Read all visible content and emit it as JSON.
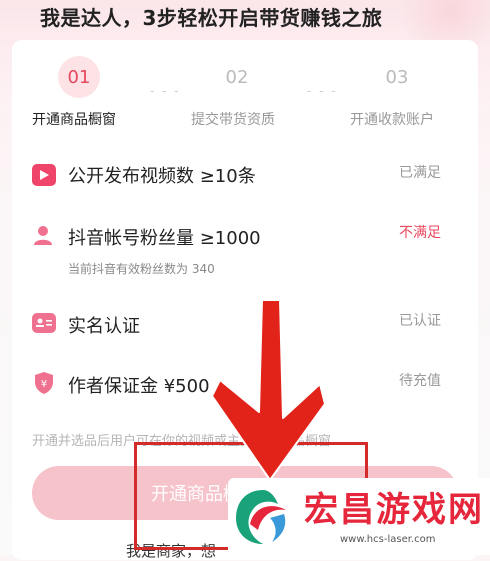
{
  "header": {
    "title": "我是达人，3步轻松开启带货赚钱之旅"
  },
  "steps": [
    {
      "number": "01",
      "label": "开通商品橱窗",
      "active": true
    },
    {
      "number": "02",
      "label": "提交带货资质",
      "active": false
    },
    {
      "number": "03",
      "label": "开通收款账户",
      "active": false
    }
  ],
  "step_separator": "- - -",
  "requirements": [
    {
      "icon": "video-icon",
      "label": "公开发布视频数 ≥10条",
      "status": "已满足"
    },
    {
      "icon": "user-icon",
      "label": "抖音帐号粉丝量 ≥1000",
      "sub": "当前抖音有效粉丝数为 340",
      "status": "不满足"
    },
    {
      "icon": "id-card-icon",
      "label": "实名认证",
      "status": "已认证"
    },
    {
      "icon": "shield-yen-icon",
      "label": "作者保证金 ¥500",
      "status": "待充值"
    }
  ],
  "note": "开通并选品后用户可在你的视频或主页看到商品橱窗",
  "cta": {
    "label": "开通商品橱窗"
  },
  "footer": {
    "text": "我是商家，想"
  },
  "watermark": {
    "title": "宏昌游戏网",
    "url": "www.hcs-laser.com"
  },
  "colors": {
    "accent": "#e9475e",
    "cta_bg": "#f6c3cb",
    "annotation_red": "#d32a2a"
  }
}
